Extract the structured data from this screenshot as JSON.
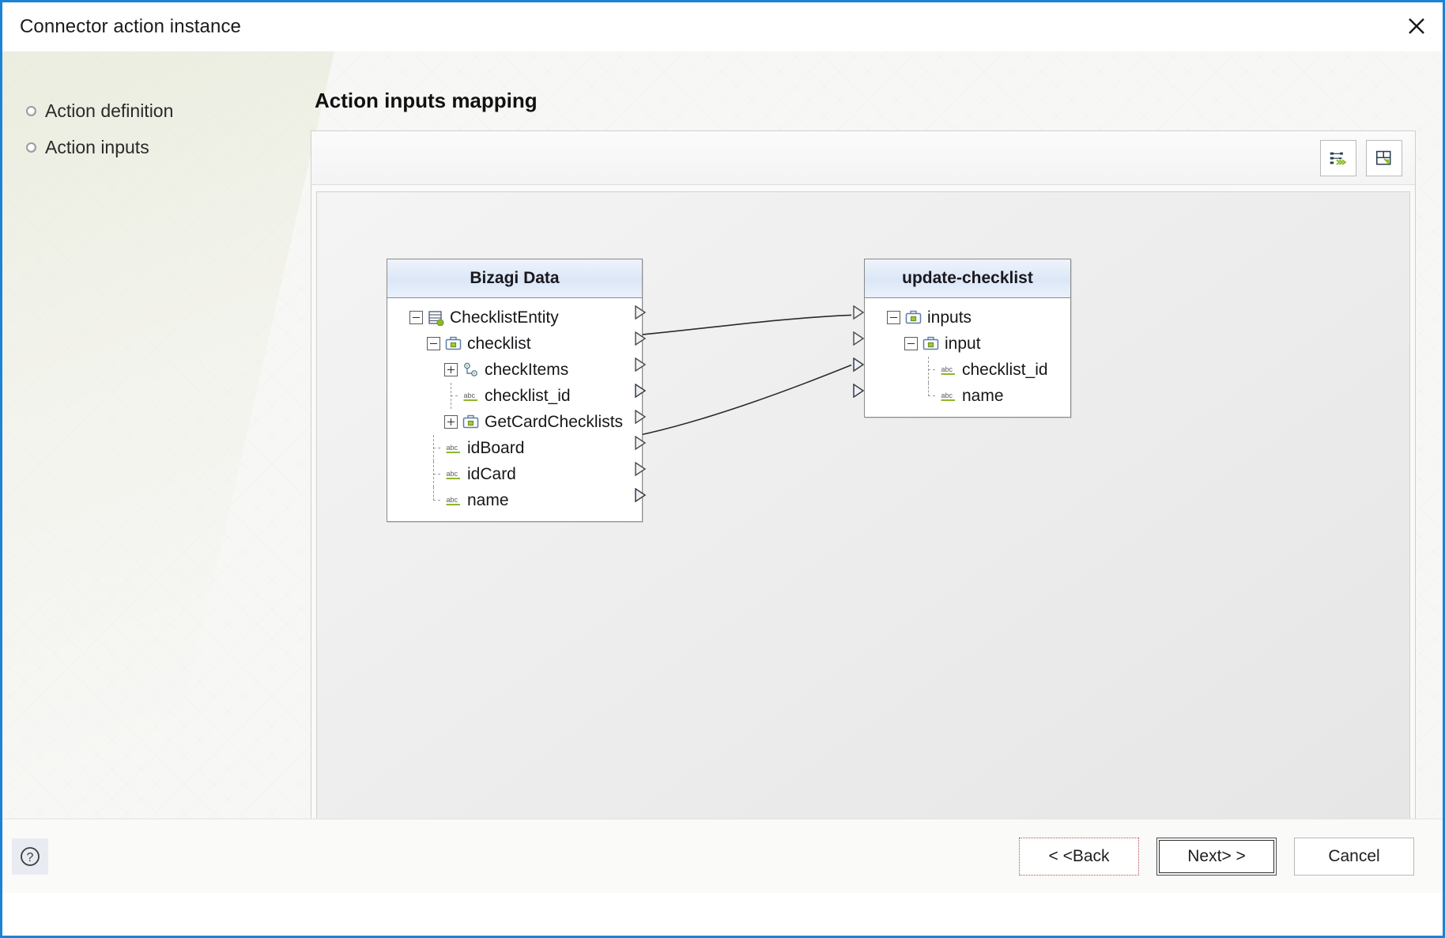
{
  "window": {
    "title": "Connector action instance",
    "close_icon": "close-icon"
  },
  "sidebar": {
    "items": [
      {
        "label": "Action definition",
        "icon": "radio-bullet-icon"
      },
      {
        "label": "Action inputs",
        "icon": "radio-bullet-icon"
      }
    ]
  },
  "main": {
    "page_title": "Action inputs mapping",
    "toolbar": {
      "buttons": [
        {
          "name": "auto-map-button",
          "icon": "auto-map-icon"
        },
        {
          "name": "arrange-layout-button",
          "icon": "arrange-layout-icon"
        }
      ]
    }
  },
  "source_panel": {
    "title": "Bizagi Data",
    "rows": [
      {
        "label": "ChecklistEntity",
        "indent": 0,
        "toggle": "minus",
        "icon": "entity-icon",
        "has_arrow": true
      },
      {
        "label": "checklist",
        "indent": 1,
        "toggle": "minus",
        "icon": "collection-icon",
        "has_arrow": true
      },
      {
        "label": "checkItems",
        "indent": 2,
        "toggle": "plus",
        "icon": "relation-icon",
        "has_arrow": true
      },
      {
        "label": "checklist_id",
        "indent": 2,
        "toggle": "none",
        "icon": "abc-icon",
        "has_arrow": true
      },
      {
        "label": "GetCardChecklists",
        "indent": 2,
        "toggle": "plus",
        "icon": "collection-icon",
        "has_arrow": true
      },
      {
        "label": "idBoard",
        "indent": 1,
        "toggle": "none",
        "icon": "abc-icon",
        "has_arrow": true
      },
      {
        "label": "idCard",
        "indent": 1,
        "toggle": "none",
        "icon": "abc-icon",
        "has_arrow": true
      },
      {
        "label": "name",
        "indent": 1,
        "toggle": "none",
        "icon": "abc-icon",
        "has_arrow": true
      }
    ]
  },
  "target_panel": {
    "title": "update-checklist",
    "rows": [
      {
        "label": "inputs",
        "indent": 0,
        "toggle": "minus",
        "icon": "collection-icon",
        "has_arrow": true
      },
      {
        "label": "input",
        "indent": 1,
        "toggle": "minus",
        "icon": "collection-icon",
        "has_arrow": true
      },
      {
        "label": "checklist_id",
        "indent": 2,
        "toggle": "none",
        "icon": "abc-icon",
        "has_arrow": true
      },
      {
        "label": "name",
        "indent": 2,
        "toggle": "none",
        "icon": "abc-icon",
        "has_arrow": true
      }
    ]
  },
  "mappings": [
    {
      "from": "checklist_id",
      "to": "checklist_id"
    },
    {
      "from": "name",
      "to": "name"
    }
  ],
  "footer": {
    "help_icon": "help-circle-icon",
    "back_label": "< <Back",
    "next_label": "Next> >",
    "cancel_label": "Cancel"
  },
  "colors": {
    "window_border": "#1a83d6",
    "panel_header": "#dce7f7",
    "icon_green": "#8cb82b",
    "icon_blue": "#5b7ea6"
  }
}
